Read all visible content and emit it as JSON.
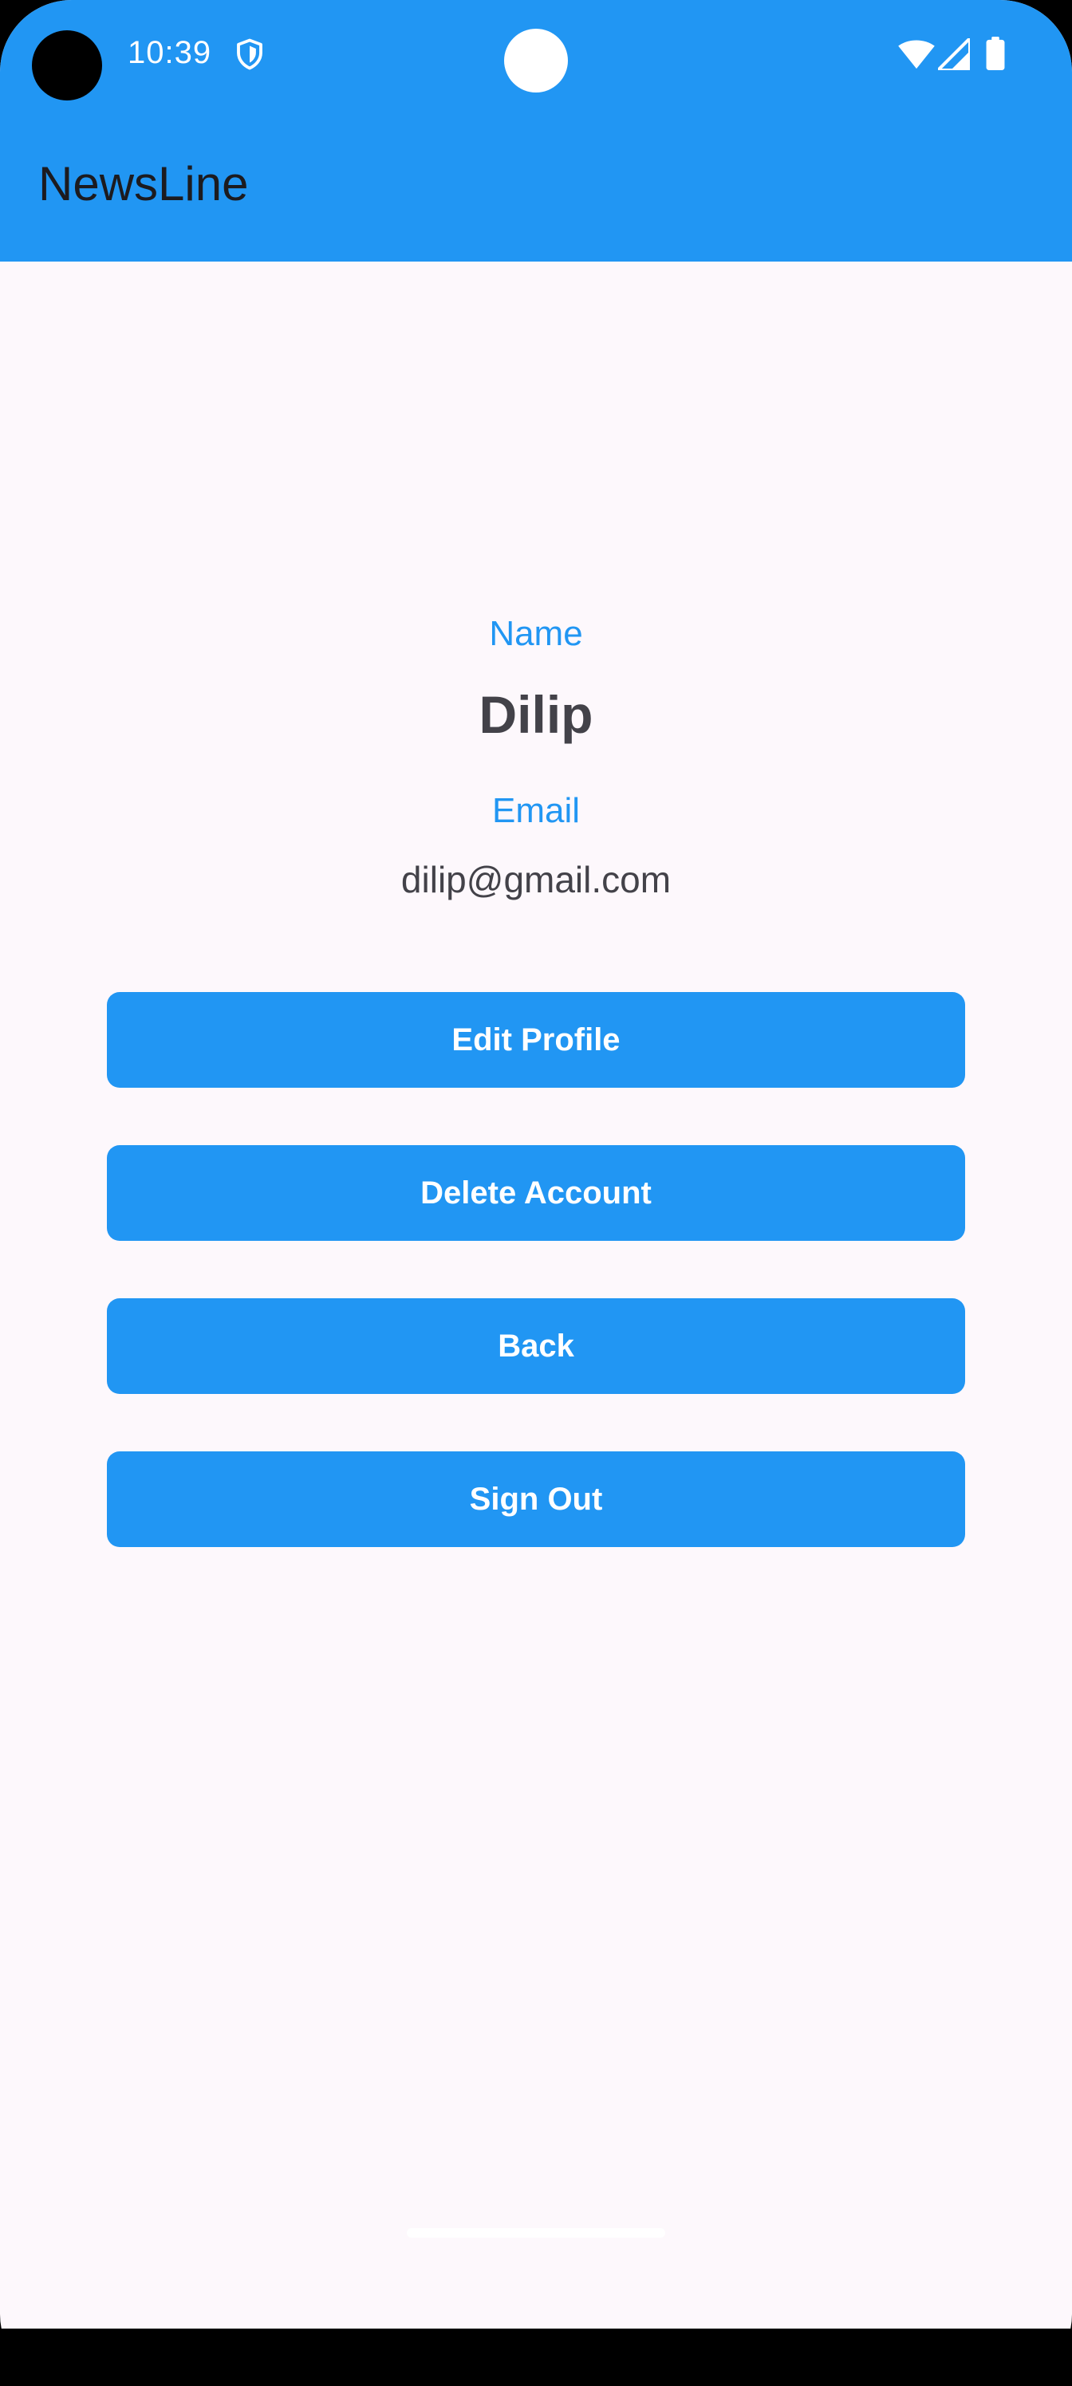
{
  "status_bar": {
    "time": "10:39",
    "icons": [
      "shield-icon",
      "wifi-icon",
      "signal-icon",
      "battery-icon"
    ]
  },
  "app_bar": {
    "title": "NewsLine"
  },
  "profile": {
    "name_label": "Name",
    "name_value": "Dilip",
    "email_label": "Email",
    "email_value": "dilip@gmail.com"
  },
  "buttons": {
    "edit_profile": "Edit Profile",
    "delete_account": "Delete Account",
    "back": "Back",
    "sign_out": "Sign Out"
  },
  "colors": {
    "primary": "#2196F3",
    "background": "#FDF8FC",
    "text_dark": "#434249",
    "on_primary": "#FFFFFF"
  }
}
